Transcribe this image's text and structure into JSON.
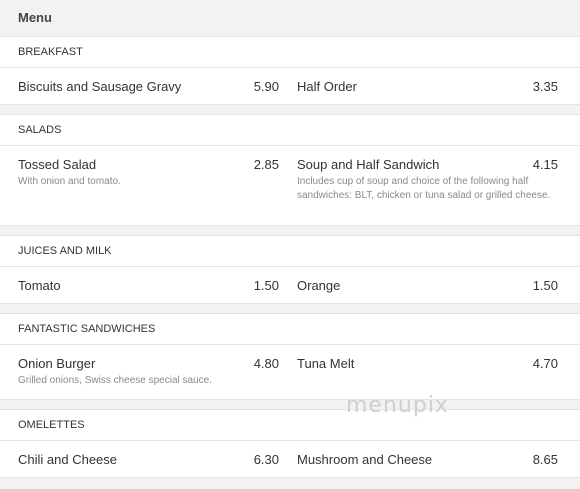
{
  "header": {
    "title": "Menu"
  },
  "sections": [
    {
      "title": "BREAKFAST",
      "items": [
        {
          "name": "Biscuits and Sausage Gravy",
          "price": "5.90",
          "desc": ""
        },
        {
          "name": "Half Order",
          "price": "3.35",
          "desc": ""
        }
      ]
    },
    {
      "title": "SALADS",
      "items": [
        {
          "name": "Tossed Salad",
          "price": "2.85",
          "desc": "With onion and tomato."
        },
        {
          "name": "Soup and Half Sandwich",
          "price": "4.15",
          "desc": "Includes cup of soup and choice of the following half sandwiches: BLT, chicken or tuna salad or grilled cheese."
        }
      ]
    },
    {
      "title": "JUICES AND MILK",
      "items": [
        {
          "name": "Tomato",
          "price": "1.50",
          "desc": ""
        },
        {
          "name": "Orange",
          "price": "1.50",
          "desc": ""
        }
      ]
    },
    {
      "title": "FANTASTIC SANDWICHES",
      "items": [
        {
          "name": "Onion Burger",
          "price": "4.80",
          "desc": "Grilled onions, Swiss cheese special sauce."
        },
        {
          "name": "Tuna Melt",
          "price": "4.70",
          "desc": ""
        }
      ]
    },
    {
      "title": "OMELETTES",
      "items": [
        {
          "name": "Chili and Cheese",
          "price": "6.30",
          "desc": ""
        },
        {
          "name": "Mushroom and Cheese",
          "price": "8.65",
          "desc": ""
        }
      ]
    }
  ],
  "watermark": "menupix"
}
